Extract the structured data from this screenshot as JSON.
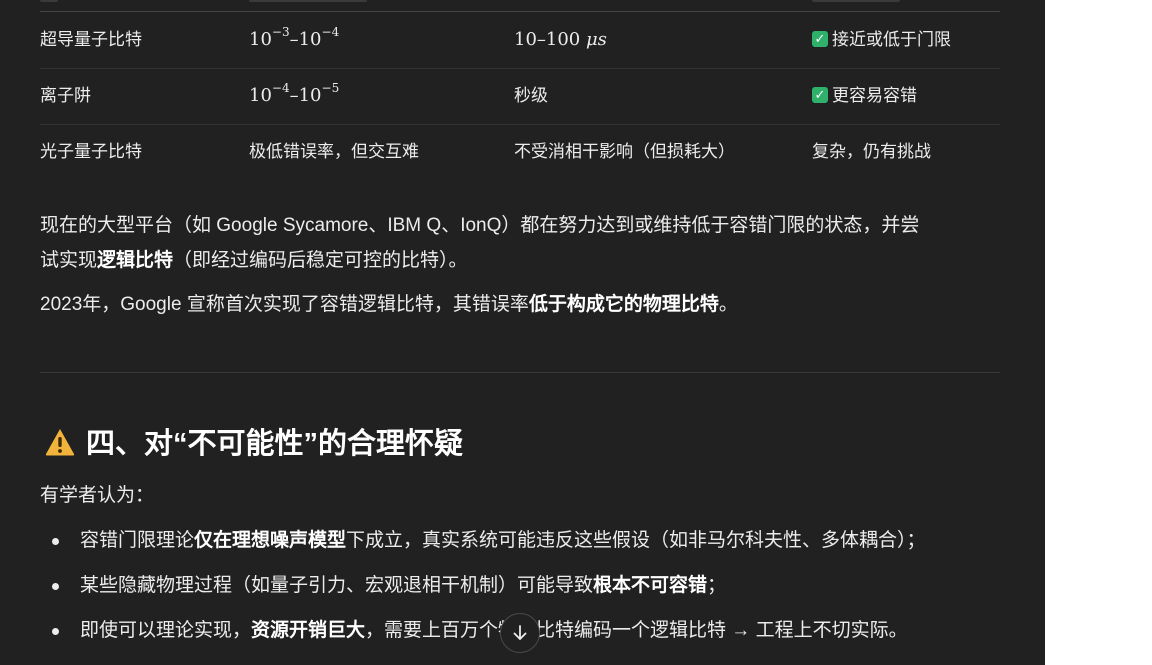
{
  "table": {
    "rows": [
      {
        "platform": "超导量子比特",
        "error_rate": {
          "base1": "10",
          "exp1": "−3",
          "sep": "–",
          "base2": "10",
          "exp2": "−4"
        },
        "coherence": {
          "text": "10–100 ",
          "unit": "μs"
        },
        "status": {
          "check": true,
          "text": "接近或低于门限"
        }
      },
      {
        "platform": "离子阱",
        "error_rate": {
          "base1": "10",
          "exp1": "−4",
          "sep": "–",
          "base2": "10",
          "exp2": "−5"
        },
        "coherence": {
          "text": "秒级",
          "unit": ""
        },
        "status": {
          "check": true,
          "text": "更容易容错"
        }
      },
      {
        "platform": "光子量子比特",
        "error_rate_text": "极低错误率，但交互难",
        "coherence": {
          "text": "不受消相干影响（但损耗大）",
          "unit": ""
        },
        "status": {
          "check": false,
          "text": "复杂，仍有挑战"
        }
      }
    ]
  },
  "para1": {
    "line1": "现在的大型平台（如 Google Sycamore、IBM Q、IonQ）都在努力达到或维持低于容错门限的状态，并尝",
    "line2_pre": "试实现",
    "line2_bold": "逻辑比特",
    "line2_post": "（即经过编码后稳定可控的比特）。"
  },
  "para2": {
    "pre": "2023年，Google 宣称首次实现了容错逻辑比特，其错误率",
    "bold": "低于构成它的物理比特",
    "post": "。"
  },
  "section": {
    "icon": "warning-icon",
    "title": "四、对“不可能性”的合理怀疑"
  },
  "intro": "有学者认为：",
  "bullets": [
    {
      "pre": "容错门限理论",
      "bold": "仅在理想噪声模型",
      "post": "下成立，真实系统可能违反这些假设（如非马尔科夫性、多体耦合）；"
    },
    {
      "pre": "某些隐藏物理过程（如量子引力、宏观退相干机制）可能导致",
      "bold": "根本不可容错",
      "post": "；"
    },
    {
      "pre": "即使可以理论实现，",
      "bold": "资源开销巨大",
      "post": "，需要上百万个物理比特编码一个逻辑比特 → 工程上不切实际。"
    }
  ],
  "scroll_button": {
    "icon": "arrow-down-icon"
  },
  "colors": {
    "background": "#212121",
    "text": "#ececec",
    "check": "#2fb16c",
    "warning": "#f2b33d"
  }
}
